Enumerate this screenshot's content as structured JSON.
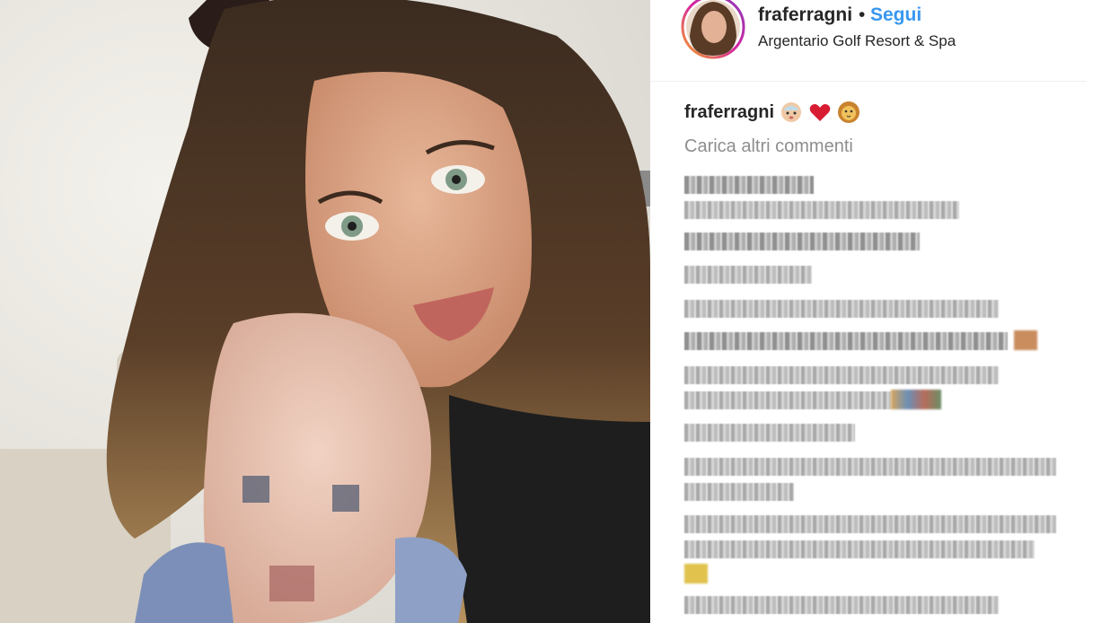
{
  "post": {
    "username": "fraferragni",
    "separator": "•",
    "follow_label": "Segui",
    "location": "Argentario Golf Resort & Spa"
  },
  "caption": {
    "username": "fraferragni",
    "emojis": [
      "baby-emoji",
      "red-heart-emoji",
      "lion-emoji"
    ]
  },
  "comments": {
    "load_more_label": "Carica altri commenti"
  },
  "colors": {
    "link": "#3897f0",
    "text": "#262626",
    "muted": "#8e8e8e"
  }
}
